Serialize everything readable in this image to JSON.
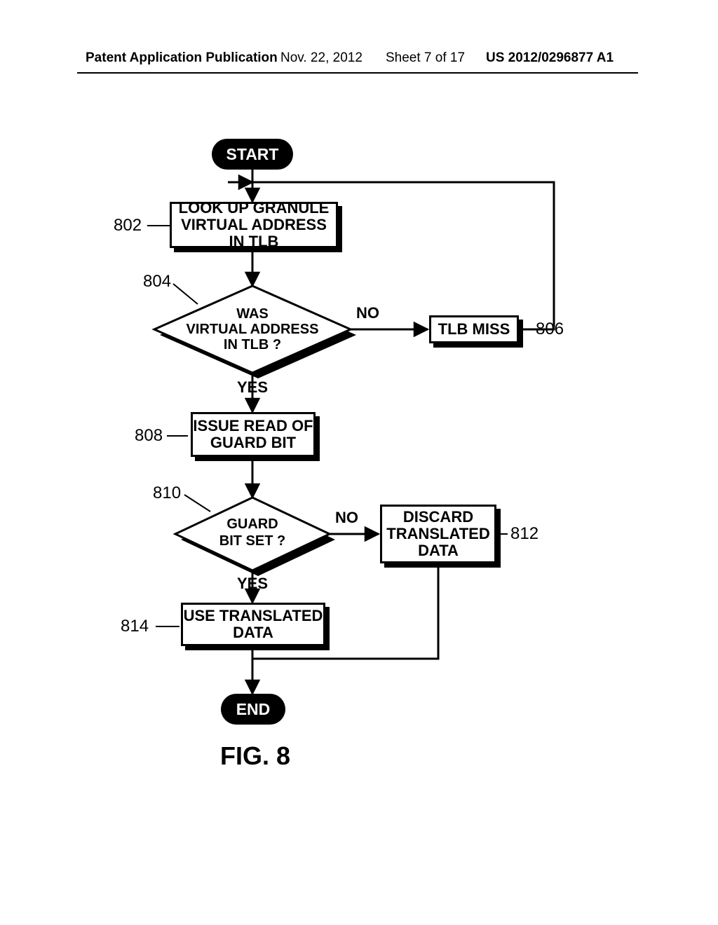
{
  "header": {
    "left": "Patent Application Publication",
    "date": "Nov. 22, 2012",
    "sheet": "Sheet 7 of 17",
    "pubnum": "US 2012/0296877 A1"
  },
  "chart_data": {
    "type": "flowchart",
    "title": "FIG. 8",
    "nodes": [
      {
        "id": "start",
        "kind": "terminator",
        "label": "START"
      },
      {
        "id": "n802",
        "kind": "process",
        "label": "LOOK UP GRANULE VIRTUAL ADDRESS IN TLB",
        "ref": "802"
      },
      {
        "id": "n804",
        "kind": "decision",
        "label": "WAS VIRTUAL ADDRESS IN TLB ?",
        "ref": "804"
      },
      {
        "id": "n806",
        "kind": "process",
        "label": "TLB MISS",
        "ref": "806"
      },
      {
        "id": "n808",
        "kind": "process",
        "label": "ISSUE READ OF GUARD BIT",
        "ref": "808"
      },
      {
        "id": "n810",
        "kind": "decision",
        "label": "GUARD BIT SET ?",
        "ref": "810"
      },
      {
        "id": "n812",
        "kind": "process",
        "label": "DISCARD TRANSLATED DATA",
        "ref": "812"
      },
      {
        "id": "n814",
        "kind": "process",
        "label": "USE TRANSLATED DATA",
        "ref": "814"
      },
      {
        "id": "end",
        "kind": "terminator",
        "label": "END"
      }
    ],
    "edges": [
      {
        "from": "start",
        "to": "n802"
      },
      {
        "from": "n802",
        "to": "n804"
      },
      {
        "from": "n804",
        "to": "n808",
        "label": "YES"
      },
      {
        "from": "n804",
        "to": "n806",
        "label": "NO"
      },
      {
        "from": "n806",
        "to": "n802",
        "note": "loop back to lookup"
      },
      {
        "from": "n808",
        "to": "n810"
      },
      {
        "from": "n810",
        "to": "n814",
        "label": "YES"
      },
      {
        "from": "n810",
        "to": "n812",
        "label": "NO"
      },
      {
        "from": "n812",
        "to": "end",
        "note": "join before END"
      },
      {
        "from": "n814",
        "to": "end"
      }
    ]
  },
  "labels": {
    "yes": "YES",
    "no": "NO"
  }
}
